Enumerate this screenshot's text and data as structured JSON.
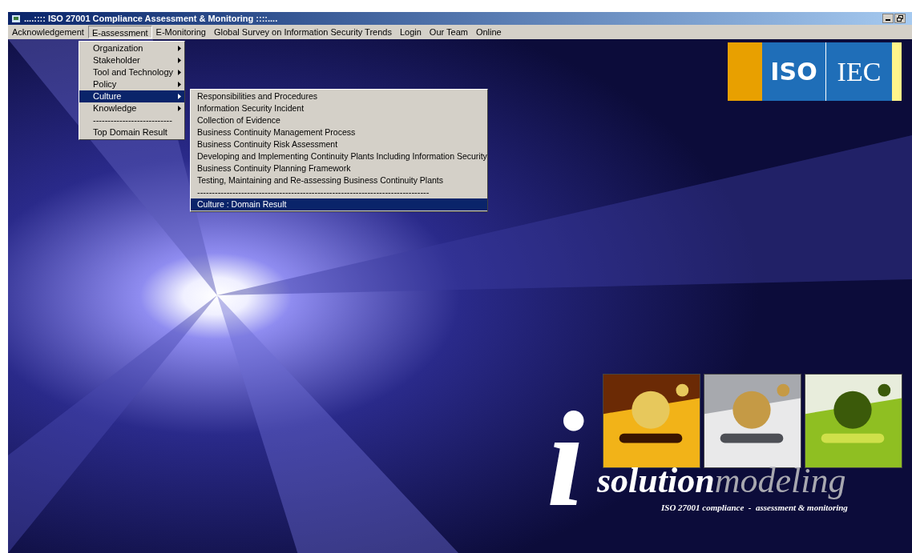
{
  "window": {
    "title": "....:::: ISO 27001 Compliance Assessment & Monitoring ::::...."
  },
  "menu_bar": [
    {
      "label": "Acknowledgement",
      "selected": false
    },
    {
      "label": "E-assessment",
      "selected": true
    },
    {
      "label": "E-Monitoring",
      "selected": false
    },
    {
      "label": "Global Survey on Information Security Trends",
      "selected": false
    },
    {
      "label": "Login",
      "selected": false
    },
    {
      "label": "Our Team",
      "selected": false
    },
    {
      "label": "Online",
      "selected": false
    }
  ],
  "dropdown": [
    {
      "kind": "item",
      "label": "Organization",
      "has_submenu": true,
      "selected": false
    },
    {
      "kind": "item",
      "label": "Stakeholder",
      "has_submenu": true,
      "selected": false
    },
    {
      "kind": "item",
      "label": "Tool and Technology",
      "has_submenu": true,
      "selected": false
    },
    {
      "kind": "item",
      "label": "Policy",
      "has_submenu": true,
      "selected": false
    },
    {
      "kind": "item",
      "label": "Culture",
      "has_submenu": true,
      "selected": true
    },
    {
      "kind": "item",
      "label": "Knowledge",
      "has_submenu": true,
      "selected": false
    },
    {
      "kind": "separator",
      "label": "---------------------------"
    },
    {
      "kind": "item",
      "label": "Top Domain Result",
      "has_submenu": false,
      "selected": false
    }
  ],
  "submenu": [
    {
      "kind": "item",
      "label": "Responsibilities and Procedures",
      "selected": false
    },
    {
      "kind": "item",
      "label": "Information Security Incident",
      "selected": false
    },
    {
      "kind": "item",
      "label": "Collection of Evidence",
      "selected": false
    },
    {
      "kind": "item",
      "label": "Business Continuity Management Process",
      "selected": false
    },
    {
      "kind": "item",
      "label": "Business Continuity Risk Assessment",
      "selected": false
    },
    {
      "kind": "item",
      "label": "Developing and Implementing Continuity Plants Including Information Security",
      "selected": false
    },
    {
      "kind": "item",
      "label": "Business Continuity Planning Framework",
      "selected": false
    },
    {
      "kind": "item",
      "label": "Testing, Maintaining and Re-assessing Business Continuity Plants",
      "selected": false
    },
    {
      "kind": "separator",
      "label": "-------------------------------------------------------------------------------"
    },
    {
      "kind": "item",
      "label": "Culture : Domain Result",
      "selected": true
    }
  ],
  "splash": {
    "logo": {
      "left": "ISO",
      "right": "IEC"
    },
    "brand": {
      "initial": "i",
      "word_1": "solution",
      "word_2": "modeling",
      "tagline": "ISO 27001 compliance  -  assessment & monitoring"
    }
  }
}
